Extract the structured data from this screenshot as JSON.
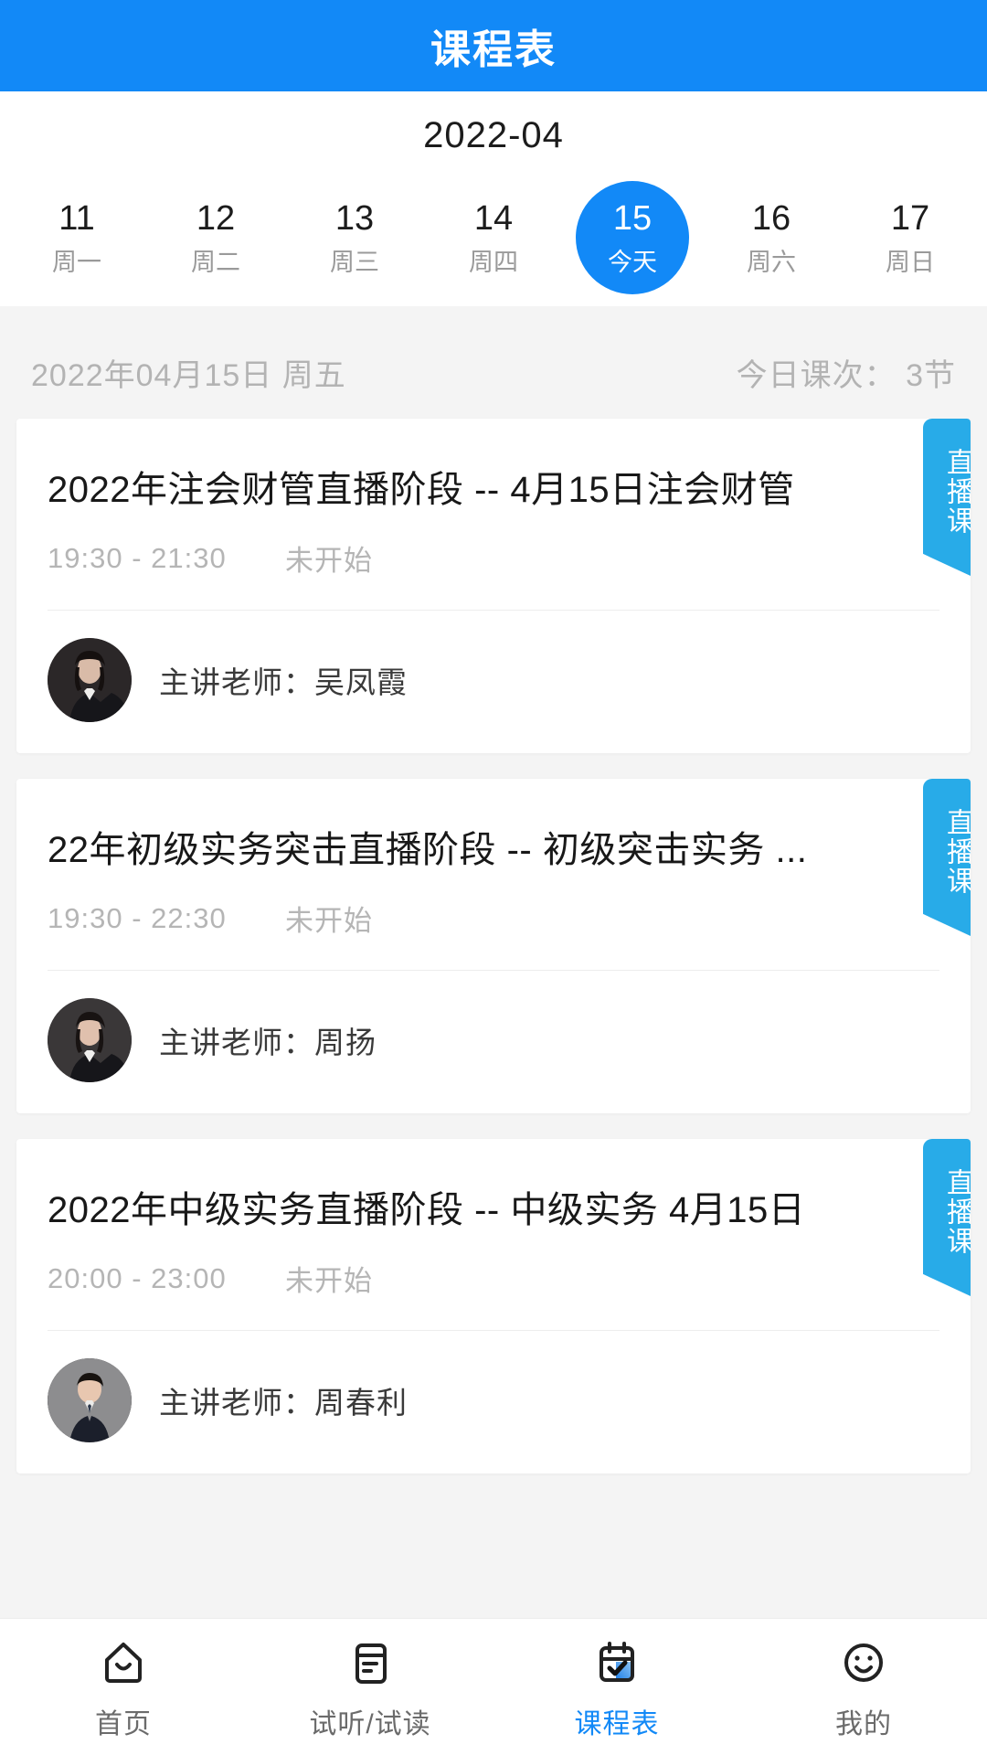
{
  "theme": {
    "primary": "#1289f7",
    "badge": "#28abe8",
    "page_bg": "#f4f4f4",
    "card_bg": "#ffffff",
    "muted_text": "#b3b3b3"
  },
  "header": {
    "title": "课程表"
  },
  "calendar": {
    "month_label": "2022-04",
    "days": [
      {
        "num": "11",
        "weekday": "周一",
        "today": false
      },
      {
        "num": "12",
        "weekday": "周二",
        "today": false
      },
      {
        "num": "13",
        "weekday": "周三",
        "today": false
      },
      {
        "num": "14",
        "weekday": "周四",
        "today": false
      },
      {
        "num": "15",
        "weekday": "今天",
        "today": true
      },
      {
        "num": "16",
        "weekday": "周六",
        "today": false
      },
      {
        "num": "17",
        "weekday": "周日",
        "today": false
      }
    ]
  },
  "summary": {
    "date_text": "2022年04月15日  周五",
    "count_text": "今日课次： 3节"
  },
  "courses": [
    {
      "title": "2022年注会财管直播阶段 -- 4月15日注会财管",
      "time": "19:30 - 21:30",
      "status": "未开始",
      "teacher_label": "主讲老师：",
      "teacher_name": "吴凤霞",
      "badge": "直播课",
      "avatar": "female-teacher-dark"
    },
    {
      "title": "22年初级实务突击直播阶段 -- 初级突击实务 ...",
      "time": "19:30 - 22:30",
      "status": "未开始",
      "teacher_label": "主讲老师：",
      "teacher_name": "周扬",
      "badge": "直播课",
      "avatar": "female-teacher-dark"
    },
    {
      "title": "2022年中级实务直播阶段 -- 中级实务 4月15日",
      "time": "20:00 - 23:00",
      "status": "未开始",
      "teacher_label": "主讲老师：",
      "teacher_name": "周春利",
      "badge": "直播课",
      "avatar": "male-teacher-gray"
    }
  ],
  "tabbar": {
    "items": [
      {
        "label": "首页",
        "icon": "home-icon",
        "active": false
      },
      {
        "label": "试听/试读",
        "icon": "note-icon",
        "active": false
      },
      {
        "label": "课程表",
        "icon": "calendar-check-icon",
        "active": true
      },
      {
        "label": "我的",
        "icon": "smiley-icon",
        "active": false
      }
    ]
  }
}
